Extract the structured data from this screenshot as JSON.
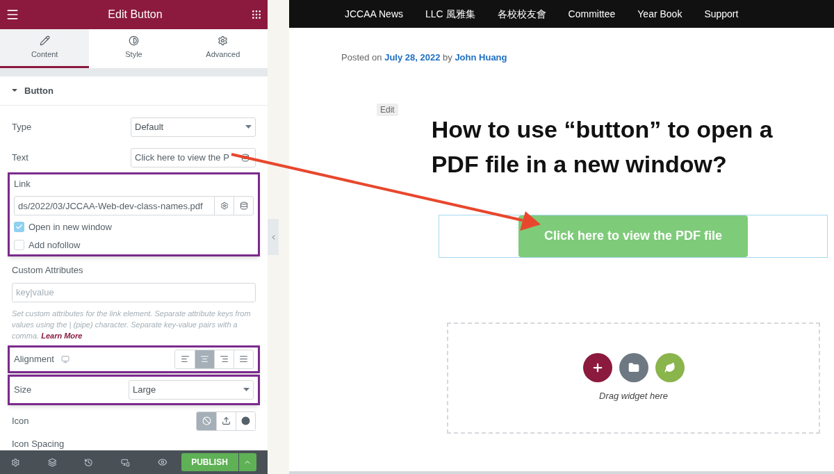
{
  "panel": {
    "title": "Edit Button",
    "tabs": [
      {
        "label": "Content",
        "selected": true,
        "kind": "pencil"
      },
      {
        "label": "Style",
        "selected": false,
        "kind": "contrast"
      },
      {
        "label": "Advanced",
        "selected": false,
        "kind": "gear"
      }
    ],
    "section": {
      "title": "Button",
      "expanded": true
    },
    "type": {
      "label": "Type",
      "value": "Default"
    },
    "text": {
      "label": "Text",
      "value": "Click here to view the P"
    },
    "link": {
      "label": "Link",
      "value": "ds/2022/03/JCCAA-Web-dev-class-names.pdf",
      "highlighted": true,
      "options": [
        {
          "label": "Open in new window",
          "checked": true
        },
        {
          "label": "Add nofollow",
          "checked": false
        }
      ]
    },
    "custom_attributes": {
      "label": "Custom Attributes",
      "placeholder": "key|value",
      "help": "Set custom attributes for the link element. Separate attribute keys from values using the | (pipe) character. Separate key-value pairs with a comma.",
      "help_link": "Learn More"
    },
    "alignment": {
      "label": "Alignment",
      "highlighted": true,
      "options": [
        {
          "kind": "left",
          "selected": false
        },
        {
          "kind": "center",
          "selected": true
        },
        {
          "kind": "right",
          "selected": false
        },
        {
          "kind": "justify",
          "selected": false
        }
      ]
    },
    "size": {
      "label": "Size",
      "value": "Large",
      "highlighted": true
    },
    "icon": {
      "label": "Icon",
      "options": [
        {
          "kind": "none",
          "selected": true
        },
        {
          "kind": "upload",
          "selected": false
        },
        {
          "kind": "circle",
          "selected": false
        }
      ]
    },
    "icon_spacing": {
      "label": "Icon Spacing"
    },
    "footer": {
      "publish": "PUBLISH"
    }
  },
  "nav": {
    "items": [
      "JCCAA News",
      "LLC 風雅集",
      "各校校友會",
      "Committee",
      "Year Book",
      "Support"
    ]
  },
  "post": {
    "posted_on": "Posted on",
    "date": "July 28, 2022",
    "by": "by",
    "author": "John Huang",
    "edit": "Edit",
    "title": "How to use “button” to open a PDF file in a new window?",
    "button": "Click here to view the PDF file",
    "drop_hint": "Drag widget here"
  }
}
